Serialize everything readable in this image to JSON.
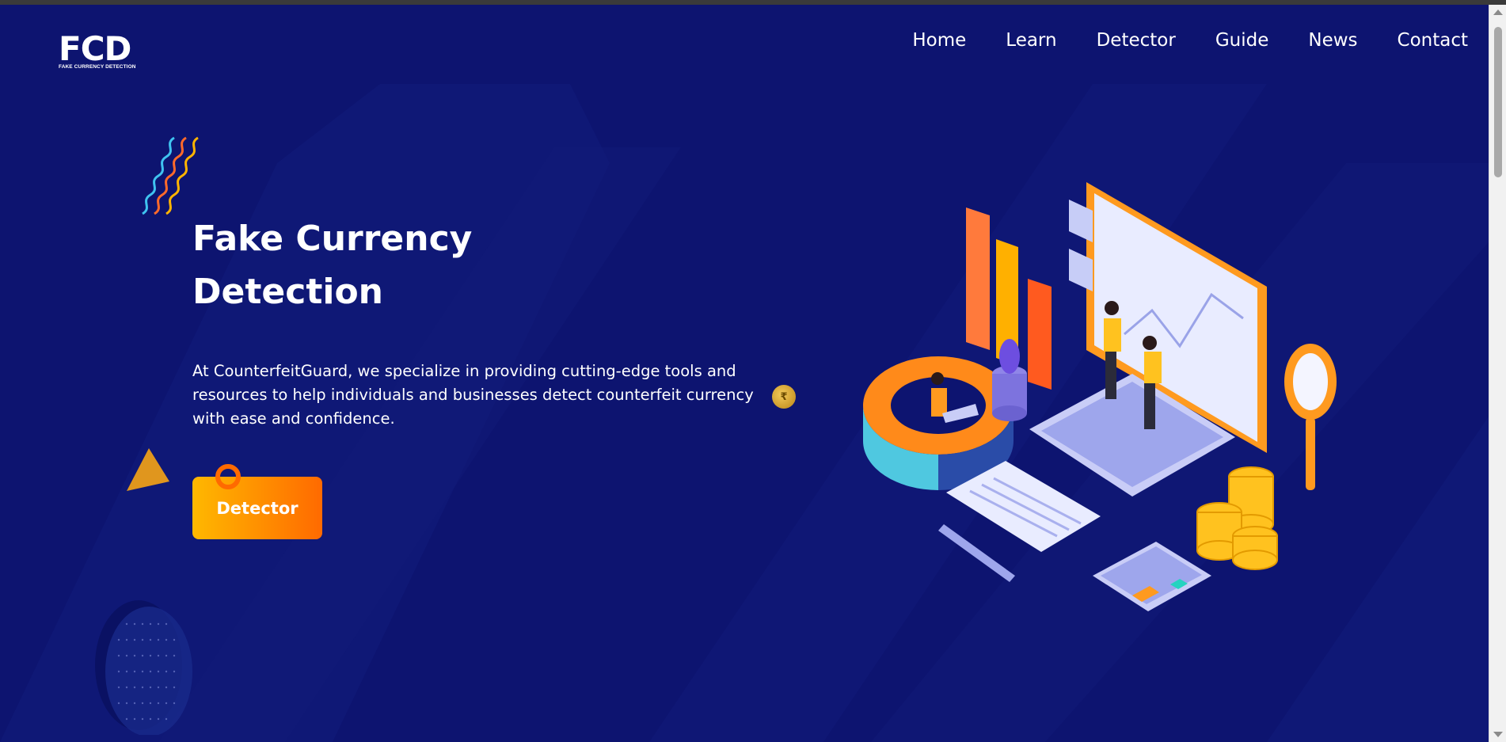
{
  "logo": {
    "mark": "FCD",
    "tagline": "FAKE CURRENCY DETECTION"
  },
  "nav": {
    "items": [
      {
        "label": "Home"
      },
      {
        "label": "Learn"
      },
      {
        "label": "Detector"
      },
      {
        "label": "Guide"
      },
      {
        "label": "News"
      },
      {
        "label": "Contact"
      }
    ]
  },
  "hero": {
    "title_line1": "Fake Currency",
    "title_line2": "Detection",
    "description": "At CounterfeitGuard, we specialize in providing cutting-edge tools and resources to help individuals and businesses detect counterfeit currency with ease and confidence.",
    "cta_label": "Detector",
    "coin_symbol": "₹"
  },
  "colors": {
    "background": "#0d1470",
    "accent_start": "#ffb800",
    "accent_end": "#ff6a00"
  }
}
